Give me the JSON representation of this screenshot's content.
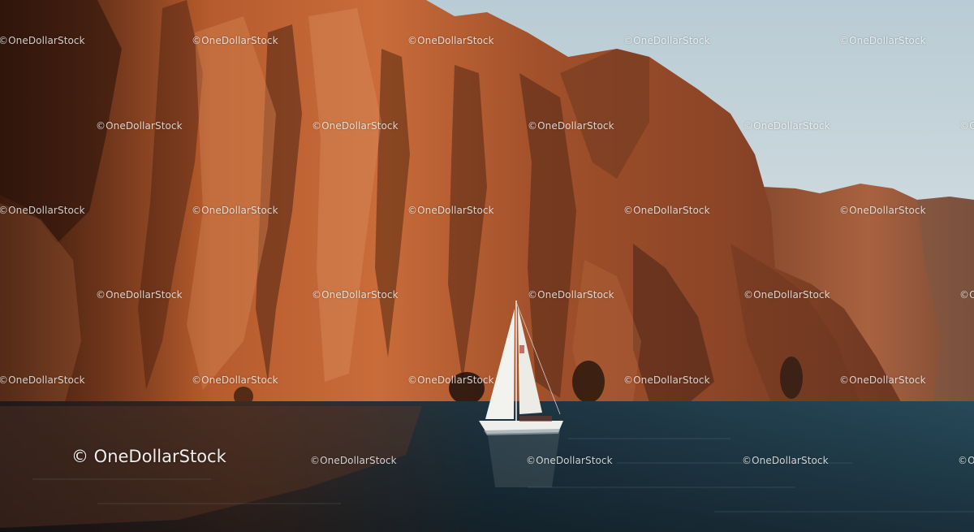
{
  "watermark": {
    "small_text": "©OneDollarStock",
    "large_text": "© OneDollarStock"
  },
  "scene": {
    "sky_color": "#c9d6dc",
    "cliff_light": "#c9733d",
    "cliff_shadow": "#5a2c18",
    "sea_color": "#1b3a4c",
    "sail_color": "#f2f2ee"
  }
}
